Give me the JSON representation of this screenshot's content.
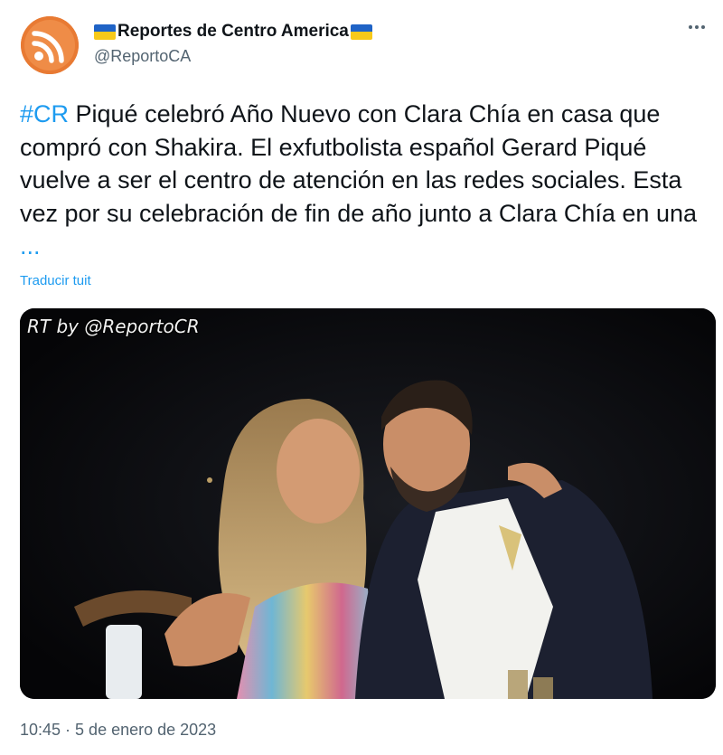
{
  "account": {
    "display_name": "Reportes de Centro America",
    "handle": "@ReportoCA"
  },
  "tweet": {
    "hashtag": "#CR",
    "body": " Piqué celebró Año Nuevo con Clara Chía en casa que compró con Shakira. El exfutbolista español Gerard Piqué vuelve a ser el centro de atención en las redes sociales. Esta vez por su celebración de fin de año junto a Clara Chía en una ",
    "ellipsis": "...",
    "translate_label": "Traducir tuit",
    "timestamp": "10:45 · 5 de enero de 2023"
  },
  "media": {
    "watermark": "RT by @ReportoCR"
  },
  "icons": {
    "avatar": "rss-feed-icon",
    "flag": "ukraine-flag-icon",
    "more": "more-options-icon"
  },
  "colors": {
    "link": "#1d9bf0",
    "secondary_text": "#536471",
    "avatar_bg": "#e87a33"
  }
}
